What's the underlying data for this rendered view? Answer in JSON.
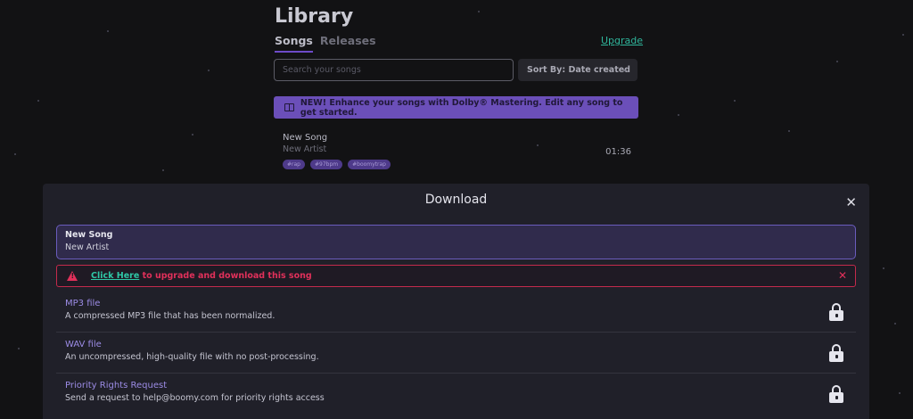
{
  "library": {
    "title": "Library",
    "tabs": [
      {
        "label": "Songs",
        "active": true
      },
      {
        "label": "Releases",
        "active": false
      }
    ],
    "upgrade_label": "Upgrade",
    "search_placeholder": "Search your songs",
    "sort_label": "Sort By: Date created",
    "banner_text": "NEW! Enhance your songs with Dolby® Mastering. Edit any song to get started.",
    "song": {
      "title": "New Song",
      "artist": "New Artist",
      "duration": "01:36",
      "tags": [
        "#rap",
        "#97bpm",
        "#boomytrap"
      ]
    }
  },
  "modal": {
    "title": "Download",
    "close_icon": "close-icon",
    "song_title": "New Song",
    "song_artist": "New Artist",
    "alert": {
      "link_text": "Click Here",
      "message": " to upgrade and download this song"
    },
    "files": [
      {
        "name": "MP3 file",
        "description": "A compressed MP3 file that has been normalized."
      },
      {
        "name": "WAV file",
        "description": "An uncompressed, high-quality file with no post-processing."
      },
      {
        "name": "Priority Rights Request",
        "description": "Send a request to help@boomy.com for priority rights access"
      }
    ]
  },
  "colors": {
    "background": "#121214",
    "accent": "#6b4fb9",
    "link": "#2fb59b",
    "error": "#e0305a",
    "modal_bg": "#202029"
  }
}
